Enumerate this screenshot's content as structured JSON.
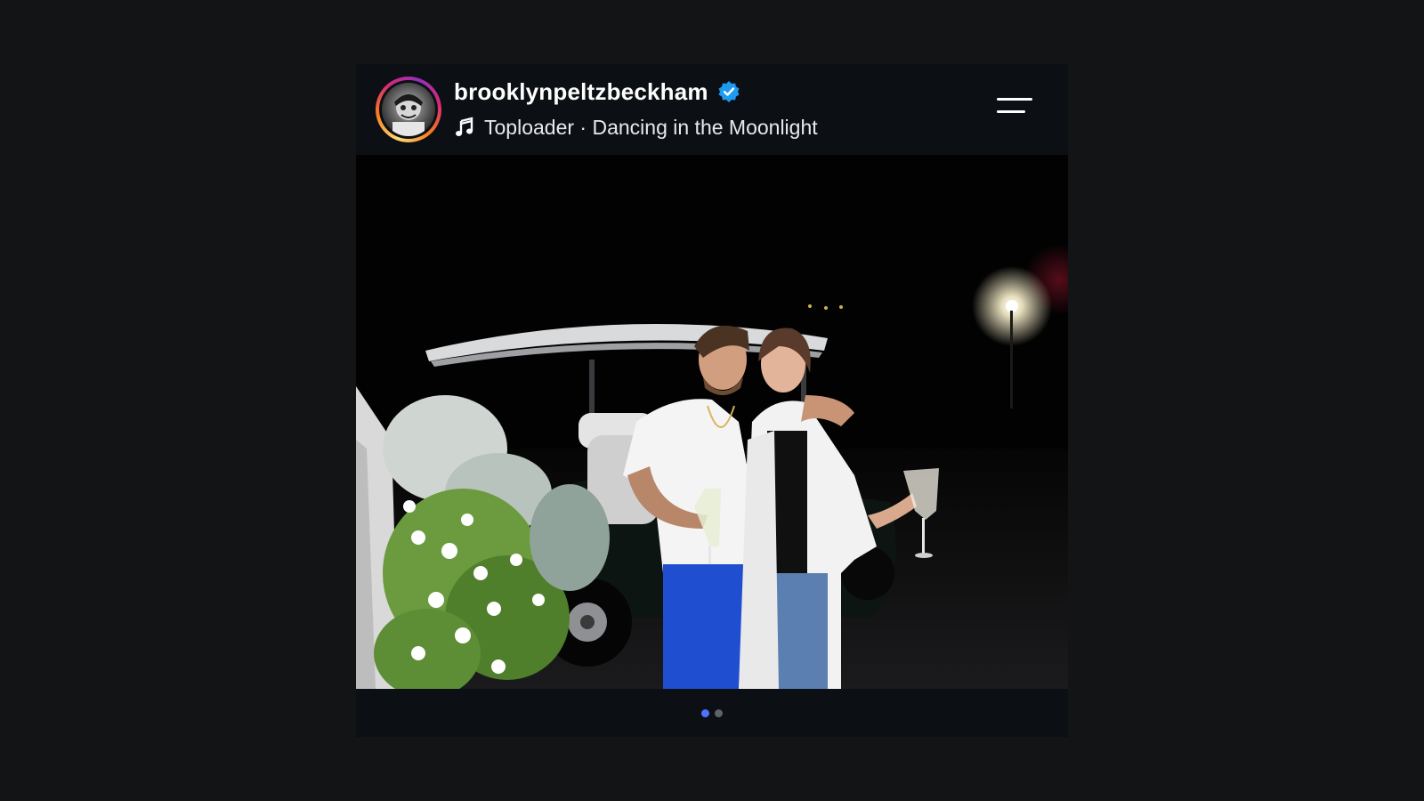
{
  "post": {
    "username": "brooklynpeltzbeckham",
    "verified": true,
    "music": {
      "artist": "Toploader",
      "separator": " · ",
      "song": "Dancing in the Moonlight"
    },
    "icons": {
      "avatar": "profile-avatar",
      "verified": "verified-badge-icon",
      "music": "music-note-icon",
      "menu": "menu-icon"
    },
    "carousel": {
      "total": 2,
      "active_index": 0
    }
  },
  "colors": {
    "background": "#131416",
    "card": "#0c0f14",
    "verified_blue": "#1d9bf0",
    "dot_active": "#4f73ff",
    "dot_inactive": "#5f6368",
    "text_primary": "#ffffff",
    "text_secondary": "#e8eaed"
  }
}
